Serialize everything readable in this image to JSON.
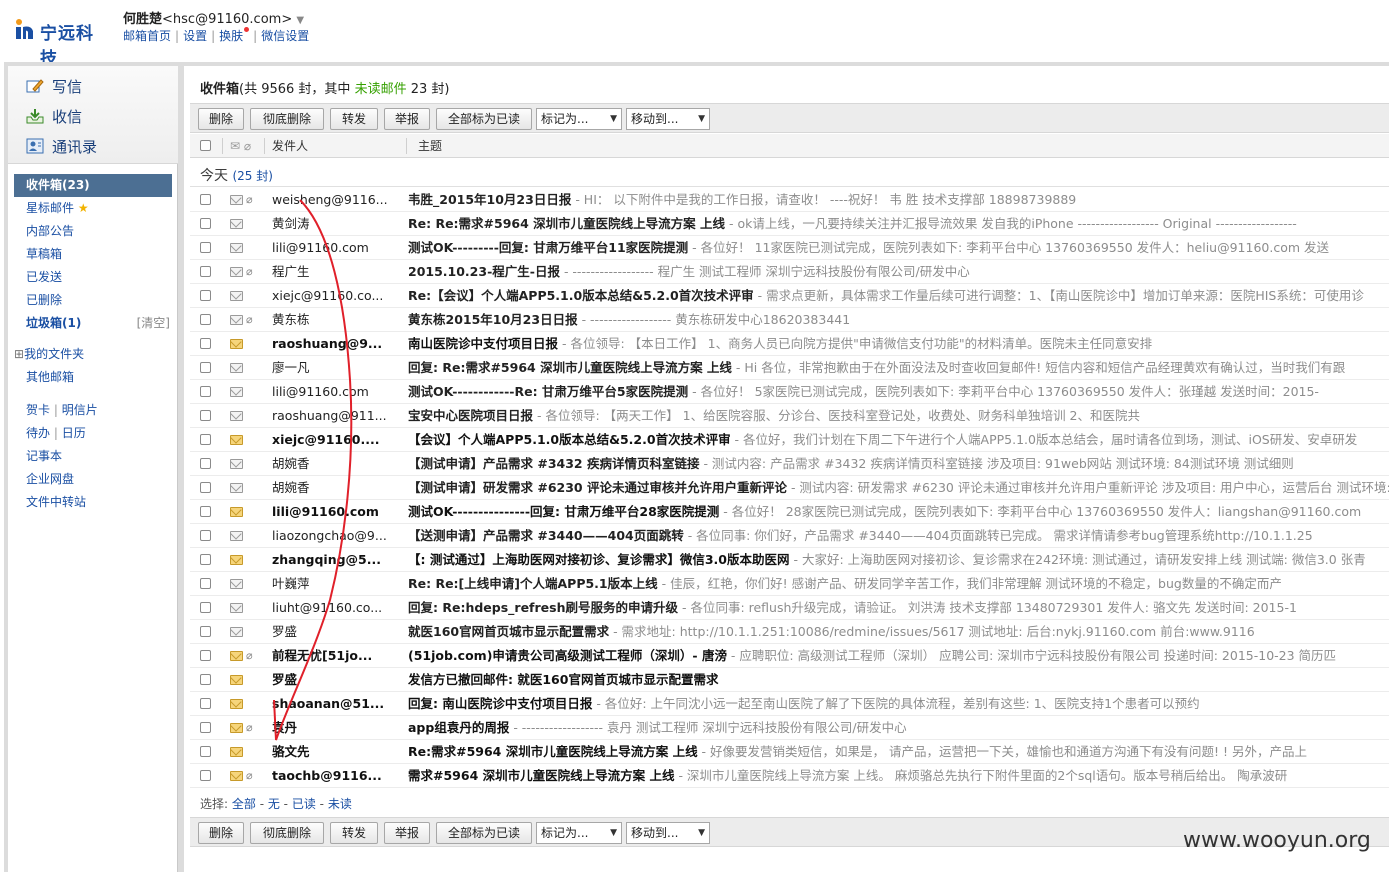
{
  "brand": {
    "logo_text": "宁远科技"
  },
  "user": {
    "name": "何胜楚",
    "email": "<hsc@91160.com>",
    "caret": "▼"
  },
  "top_links": [
    "邮箱首页",
    "设置",
    "换肤",
    "微信设置"
  ],
  "actions": {
    "compose": "写信",
    "receive": "收信",
    "contacts": "通讯录"
  },
  "folders": {
    "inbox": "收件箱(23)",
    "starred": "星标邮件",
    "notice": "内部公告",
    "drafts": "草稿箱",
    "sent": "已发送",
    "deleted": "已删除",
    "spam": "垃圾箱(1)",
    "spam_clear": "[清空]",
    "my_folders": "我的文件夹",
    "other_mail": "其他邮箱",
    "card": "贺卡",
    "postcard": "明信片",
    "todo": "待办",
    "calendar": "日历",
    "notes": "记事本",
    "netdisk": "企业网盘",
    "transfer": "文件中转站"
  },
  "header": {
    "title": "收件箱",
    "count_prefix": "(共 9566 封，其中 ",
    "unread_label": "未读邮件",
    "count_suffix": " 23 封)"
  },
  "toolbar": {
    "delete": "删除",
    "purge": "彻底删除",
    "forward": "转发",
    "report": "举报",
    "mark_all_read": "全部标为已读",
    "mark_as": "标记为...",
    "move_to": "移动到..."
  },
  "columns": {
    "sender": "发件人",
    "subject": "主题"
  },
  "group": {
    "label": "今天",
    "count": "(25 封)"
  },
  "emails": [
    {
      "from": "weisheng@9116...",
      "subject": "韦胜_2015年10月23日日报",
      "preview": " - HI： 以下附件中是我的工作日报，请查收！ ----祝好！ 韦 胜 技术支撑部 18898739889",
      "unread": false,
      "attach": true
    },
    {
      "from": "黄剑涛",
      "subject": "Re: Re:需求#5964 深圳市儿童医院线上导流方案 上线",
      "preview": " - ok请上线，一凡要持续关注并汇报导流效果 发自我的iPhone ------------------ Original ------------------",
      "unread": false,
      "attach": false
    },
    {
      "from": "lili@91160.com",
      "subject": "测试OK---------回复: 甘肃万维平台11家医院提测",
      "preview": " - 各位好！ 11家医院已测试完成，医院列表如下: 李莉平台中心 13760369550 发件人：heliu@91160.com 发送",
      "unread": false,
      "attach": false
    },
    {
      "from": "程广生",
      "subject": "2015.10.23-程广生-日报",
      "preview": " - ------------------ 程广生 测试工程师 深圳宁远科技股份有限公司/研发中心",
      "unread": false,
      "attach": true
    },
    {
      "from": "xiejc@91160.co...",
      "subject": "Re:【会议】个人端APP5.1.0版本总结&5.2.0首次技术评审",
      "preview": " - 需求点更新，具体需求工作量后续可进行调整：1、【南山医院诊中】增加订单来源：医院HIS系统：可使用诊",
      "unread": false,
      "attach": false
    },
    {
      "from": "黄东栋",
      "subject": "黄东栋2015年10月23日日报",
      "preview": " - ------------------ 黄东栋研发中心18620383441",
      "unread": false,
      "attach": true
    },
    {
      "from": "raoshuang@9...",
      "subject": "南山医院诊中支付项目日报",
      "preview": " - 各位领导: 【本日工作】 1、商务人员已向院方提供\"申请微信支付功能\"的材料清单。医院未主任同意安排",
      "unread": true,
      "attach": false
    },
    {
      "from": "廖一凡",
      "subject": "回复: Re:需求#5964 深圳市儿童医院线上导流方案 上线",
      "preview": " - Hi 各位，非常抱歉由于在外面没法及时查收回复邮件! 短信内容和短信产品经理黄欢有确认过，当时我们有跟",
      "unread": false,
      "attach": false
    },
    {
      "from": "lili@91160.com",
      "subject": "测试OK------------Re: 甘肃万维平台5家医院提测",
      "preview": " - 各位好！ 5家医院已测试完成，医院列表如下: 李莉平台中心 13760369550 发件人：张瑾越 发送时间：2015-",
      "unread": false,
      "attach": false
    },
    {
      "from": "raoshuang@911...",
      "subject": "宝安中心医院项目日报",
      "preview": " - 各位领导: 【两天工作】 1、给医院容服、分诊台、医技科室登记处，收费处、财务科单独培训 2、和医院共",
      "unread": false,
      "attach": false
    },
    {
      "from": "xiejc@91160....",
      "subject": "【会议】个人端APP5.1.0版本总结&5.2.0首次技术评审",
      "preview": " - 各位好，我们计划在下周二下午进行个人端APP5.1.0版本总结会，届时请各位到场，测试、iOS研发、安卓研发",
      "unread": true,
      "attach": false
    },
    {
      "from": "胡婉香",
      "subject": "【测试申请】产品需求 #3432 疾病详情页科室链接",
      "preview": " - 测试内容: 产品需求 #3432 疾病详情页科室链接 涉及项目: 91web网站 测试环境: 84测试环境 测试细则",
      "unread": false,
      "attach": false
    },
    {
      "from": "胡婉香",
      "subject": "【测试申请】研发需求 #6230 评论未通过审核并允许用户重新评论",
      "preview": " - 测试内容: 研发需求 #6230 评论未通过审核并允许用户重新评论 涉及项目: 用户中心，运营后台 测试环境:",
      "unread": false,
      "attach": false
    },
    {
      "from": "lili@91160.com",
      "subject": "测试OK---------------回复: 甘肃万维平台28家医院提测",
      "preview": " - 各位好！ 28家医院已测试完成，医院列表如下: 李莉平台中心 13760369550 发件人：liangshan@91160.com",
      "unread": true,
      "attach": false
    },
    {
      "from": "liaozongchao@9...",
      "subject": "【送测申请】产品需求 #3440——404页面跳转",
      "preview": " - 各位同事: 你们好，产品需求 #3440——404页面跳转已完成。 需求详情请参考bug管理系统http://10.1.1.25",
      "unread": false,
      "attach": false
    },
    {
      "from": "zhangqing@5...",
      "subject": "【: 测试通过】上海助医网对接初诊、复诊需求】微信3.0版本助医网",
      "preview": " - 大家好: 上海助医网对接初诊、复诊需求在242环境: 测试通过，请研发安排上线 测试端: 微信3.0 张青",
      "unread": true,
      "attach": false
    },
    {
      "from": "叶巍萍",
      "subject": "Re: Re:[上线申请]个人端APP5.1版本上线",
      "preview": " - 佳辰，红艳，你们好! 感谢产品、研发同学辛苦工作，我们非常理解 测试环境的不稳定，bug数量的不确定而产",
      "unread": false,
      "attach": false
    },
    {
      "from": "liuht@91160.co...",
      "subject": "回复: Re:hdeps_refresh刷号服务的申请升级",
      "preview": " - 各位同事: reflush升级完成，请验证。 刘洪涛 技术支撑部 13480729301 发件人: 骆文先 发送时间: 2015-1",
      "unread": false,
      "attach": false
    },
    {
      "from": "罗盛",
      "subject": "就医160官网首页城市显示配置需求",
      "preview": " - 需求地址: http://10.1.1.251:10086/redmine/issues/5617 测试地址: 后台:nykj.91160.com 前台:www.9116",
      "unread": false,
      "attach": false
    },
    {
      "from": "前程无忧[51jo...",
      "subject": "(51job.com)申请贵公司高级测试工程师（深圳）- 唐滂",
      "preview": " - 应聘职位: 高级测试工程师（深圳） 应聘公司: 深圳市宁远科技股份有限公司 投递时间: 2015-10-23 简历匹",
      "unread": true,
      "attach": true
    },
    {
      "from": "罗盛",
      "subject": "发信方已撤回邮件: 就医160官网首页城市显示配置需求",
      "preview": "",
      "unread": true,
      "attach": false
    },
    {
      "from": "shaoanan@51...",
      "subject": "回复: 南山医院诊中支付项目日报",
      "preview": " - 各位好: 上午同沈小远一起至南山医院了解了下医院的具体流程，差别有这些: 1、医院支持1个患者可以预约",
      "unread": true,
      "attach": false
    },
    {
      "from": "袁丹",
      "subject": "app组袁丹的周报",
      "preview": " - ------------------ 袁丹 测试工程师 深圳宁远科技股份有限公司/研发中心",
      "unread": true,
      "attach": true
    },
    {
      "from": "骆文先",
      "subject": "Re:需求#5964 深圳市儿童医院线上导流方案 上线",
      "preview": " - 好像要发营销类短信，如果是， 请产品，运营把一下关，雄愉也和通道方沟通下有没有问题! ! 另外，产品上",
      "unread": true,
      "attach": false
    },
    {
      "from": "taochb@9116...",
      "subject": "需求#5964 深圳市儿童医院线上导流方案 上线",
      "preview": " - 深圳市儿童医院线上导流方案 上线。 麻烦骆总先执行下附件里面的2个sql语句。版本号稍后给出。 陶承波研",
      "unread": true,
      "attach": true
    }
  ],
  "select_bar": {
    "label": "选择: ",
    "all": "全部",
    "none": "无",
    "read": "已读",
    "unread": "未读"
  },
  "watermark": "www.wooyun.org"
}
